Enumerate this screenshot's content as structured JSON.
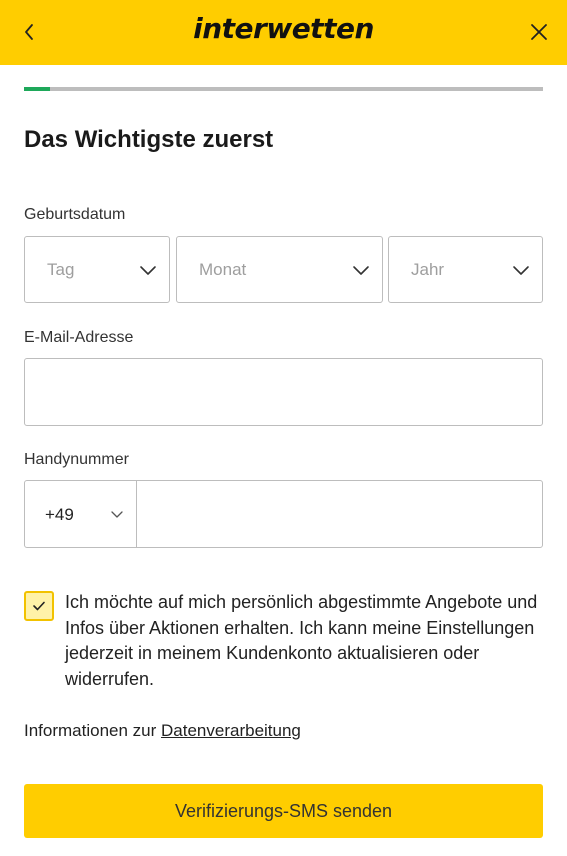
{
  "header": {
    "logo_text": "interwetten",
    "bg_color": "#FFCD00"
  },
  "progress": {
    "fraction": 0.05,
    "color": "#1EA85A"
  },
  "page_title": "Das Wichtigste zuerst",
  "birthdate": {
    "label": "Geburtsdatum",
    "day_placeholder": "Tag",
    "month_placeholder": "Monat",
    "year_placeholder": "Jahr"
  },
  "email": {
    "label": "E-Mail-Adresse",
    "value": ""
  },
  "phone": {
    "label": "Handynummer",
    "country_code": "+49",
    "value": ""
  },
  "consent": {
    "checked": true,
    "text": "Ich möchte auf mich persönlich abgestimmte Angebote und Infos über Aktionen erhalten. Ich kann meine Einstellungen jederzeit in meinem Kundenkonto aktualisieren oder widerrufen."
  },
  "info": {
    "prefix": "Informationen zur ",
    "link": "Datenverarbeitung"
  },
  "submit_label": "Verifizierungs-SMS senden",
  "icons": {
    "back": "chevron-left-icon",
    "close": "close-icon",
    "dropdown": "chevron-down-icon",
    "check": "checkmark-icon"
  }
}
